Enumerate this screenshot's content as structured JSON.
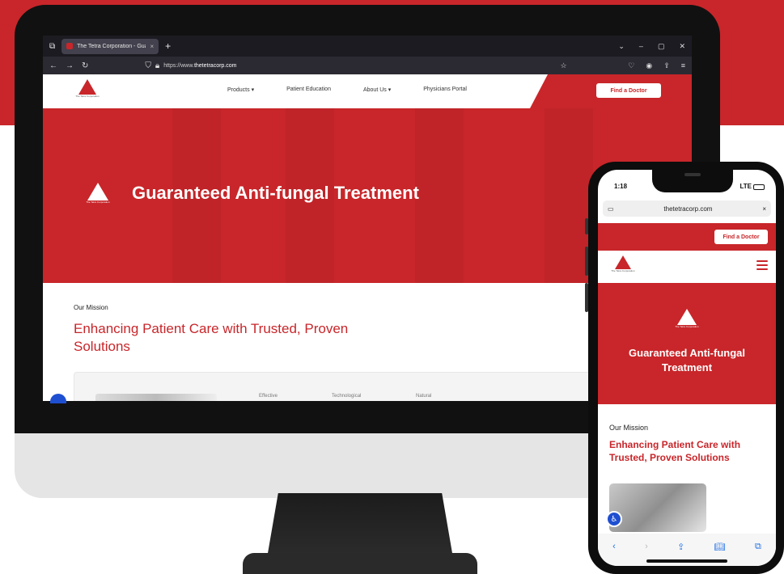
{
  "desktop": {
    "tab_title": "The Tetra Corporation - Guaran",
    "tab_close": "×",
    "new_tab": "+",
    "url_prefix": "https://www.",
    "url_domain": "thetetracorp.com",
    "site": {
      "logo_caption": "The Tetra Corporation",
      "menu": [
        "Products ▾",
        "Patient Education",
        "About Us ▾",
        "Physicians Portal"
      ],
      "find_doctor": "Find a Doctor",
      "hero_title": "Guaranteed Anti-fungal Treatment",
      "mission_label": "Our Mission",
      "mission_heading": "Enhancing Patient Care with Trusted, Proven Solutions",
      "card_features": [
        "Effective",
        "Technological",
        "Natural"
      ]
    }
  },
  "phone": {
    "time": "1:18",
    "network": "LTE",
    "url": "thetetracorp.com",
    "close": "×",
    "find_doctor": "Find a Doctor",
    "logo_caption": "The Tetra Corporation",
    "hero_title": "Guaranteed Anti-fungal Treatment",
    "mission_label": "Our Mission",
    "mission_heading": "Enhancing Patient Care with Trusted, Proven Solutions"
  },
  "colors": {
    "brand_red": "#c8262a",
    "accessibility_blue": "#1f4fd1"
  }
}
